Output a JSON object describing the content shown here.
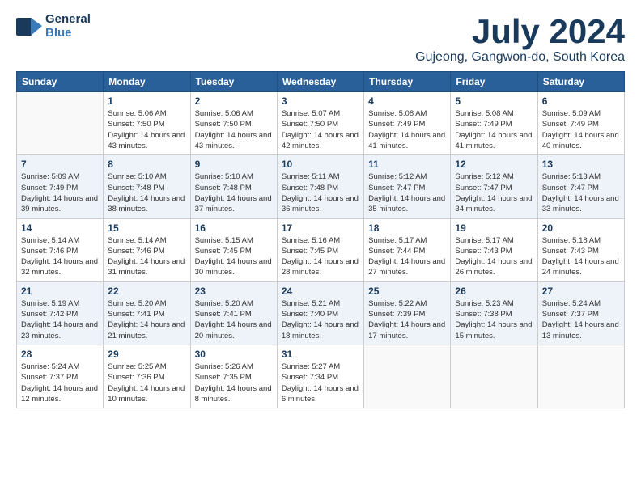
{
  "header": {
    "logo_line1": "General",
    "logo_line2": "Blue",
    "month": "July 2024",
    "location": "Gujeong, Gangwon-do, South Korea"
  },
  "weekdays": [
    "Sunday",
    "Monday",
    "Tuesday",
    "Wednesday",
    "Thursday",
    "Friday",
    "Saturday"
  ],
  "weeks": [
    [
      {
        "day": "",
        "sunrise": "",
        "sunset": "",
        "daylight": ""
      },
      {
        "day": "1",
        "sunrise": "Sunrise: 5:06 AM",
        "sunset": "Sunset: 7:50 PM",
        "daylight": "Daylight: 14 hours and 43 minutes."
      },
      {
        "day": "2",
        "sunrise": "Sunrise: 5:06 AM",
        "sunset": "Sunset: 7:50 PM",
        "daylight": "Daylight: 14 hours and 43 minutes."
      },
      {
        "day": "3",
        "sunrise": "Sunrise: 5:07 AM",
        "sunset": "Sunset: 7:50 PM",
        "daylight": "Daylight: 14 hours and 42 minutes."
      },
      {
        "day": "4",
        "sunrise": "Sunrise: 5:08 AM",
        "sunset": "Sunset: 7:49 PM",
        "daylight": "Daylight: 14 hours and 41 minutes."
      },
      {
        "day": "5",
        "sunrise": "Sunrise: 5:08 AM",
        "sunset": "Sunset: 7:49 PM",
        "daylight": "Daylight: 14 hours and 41 minutes."
      },
      {
        "day": "6",
        "sunrise": "Sunrise: 5:09 AM",
        "sunset": "Sunset: 7:49 PM",
        "daylight": "Daylight: 14 hours and 40 minutes."
      }
    ],
    [
      {
        "day": "7",
        "sunrise": "Sunrise: 5:09 AM",
        "sunset": "Sunset: 7:49 PM",
        "daylight": "Daylight: 14 hours and 39 minutes."
      },
      {
        "day": "8",
        "sunrise": "Sunrise: 5:10 AM",
        "sunset": "Sunset: 7:48 PM",
        "daylight": "Daylight: 14 hours and 38 minutes."
      },
      {
        "day": "9",
        "sunrise": "Sunrise: 5:10 AM",
        "sunset": "Sunset: 7:48 PM",
        "daylight": "Daylight: 14 hours and 37 minutes."
      },
      {
        "day": "10",
        "sunrise": "Sunrise: 5:11 AM",
        "sunset": "Sunset: 7:48 PM",
        "daylight": "Daylight: 14 hours and 36 minutes."
      },
      {
        "day": "11",
        "sunrise": "Sunrise: 5:12 AM",
        "sunset": "Sunset: 7:47 PM",
        "daylight": "Daylight: 14 hours and 35 minutes."
      },
      {
        "day": "12",
        "sunrise": "Sunrise: 5:12 AM",
        "sunset": "Sunset: 7:47 PM",
        "daylight": "Daylight: 14 hours and 34 minutes."
      },
      {
        "day": "13",
        "sunrise": "Sunrise: 5:13 AM",
        "sunset": "Sunset: 7:47 PM",
        "daylight": "Daylight: 14 hours and 33 minutes."
      }
    ],
    [
      {
        "day": "14",
        "sunrise": "Sunrise: 5:14 AM",
        "sunset": "Sunset: 7:46 PM",
        "daylight": "Daylight: 14 hours and 32 minutes."
      },
      {
        "day": "15",
        "sunrise": "Sunrise: 5:14 AM",
        "sunset": "Sunset: 7:46 PM",
        "daylight": "Daylight: 14 hours and 31 minutes."
      },
      {
        "day": "16",
        "sunrise": "Sunrise: 5:15 AM",
        "sunset": "Sunset: 7:45 PM",
        "daylight": "Daylight: 14 hours and 30 minutes."
      },
      {
        "day": "17",
        "sunrise": "Sunrise: 5:16 AM",
        "sunset": "Sunset: 7:45 PM",
        "daylight": "Daylight: 14 hours and 28 minutes."
      },
      {
        "day": "18",
        "sunrise": "Sunrise: 5:17 AM",
        "sunset": "Sunset: 7:44 PM",
        "daylight": "Daylight: 14 hours and 27 minutes."
      },
      {
        "day": "19",
        "sunrise": "Sunrise: 5:17 AM",
        "sunset": "Sunset: 7:43 PM",
        "daylight": "Daylight: 14 hours and 26 minutes."
      },
      {
        "day": "20",
        "sunrise": "Sunrise: 5:18 AM",
        "sunset": "Sunset: 7:43 PM",
        "daylight": "Daylight: 14 hours and 24 minutes."
      }
    ],
    [
      {
        "day": "21",
        "sunrise": "Sunrise: 5:19 AM",
        "sunset": "Sunset: 7:42 PM",
        "daylight": "Daylight: 14 hours and 23 minutes."
      },
      {
        "day": "22",
        "sunrise": "Sunrise: 5:20 AM",
        "sunset": "Sunset: 7:41 PM",
        "daylight": "Daylight: 14 hours and 21 minutes."
      },
      {
        "day": "23",
        "sunrise": "Sunrise: 5:20 AM",
        "sunset": "Sunset: 7:41 PM",
        "daylight": "Daylight: 14 hours and 20 minutes."
      },
      {
        "day": "24",
        "sunrise": "Sunrise: 5:21 AM",
        "sunset": "Sunset: 7:40 PM",
        "daylight": "Daylight: 14 hours and 18 minutes."
      },
      {
        "day": "25",
        "sunrise": "Sunrise: 5:22 AM",
        "sunset": "Sunset: 7:39 PM",
        "daylight": "Daylight: 14 hours and 17 minutes."
      },
      {
        "day": "26",
        "sunrise": "Sunrise: 5:23 AM",
        "sunset": "Sunset: 7:38 PM",
        "daylight": "Daylight: 14 hours and 15 minutes."
      },
      {
        "day": "27",
        "sunrise": "Sunrise: 5:24 AM",
        "sunset": "Sunset: 7:37 PM",
        "daylight": "Daylight: 14 hours and 13 minutes."
      }
    ],
    [
      {
        "day": "28",
        "sunrise": "Sunrise: 5:24 AM",
        "sunset": "Sunset: 7:37 PM",
        "daylight": "Daylight: 14 hours and 12 minutes."
      },
      {
        "day": "29",
        "sunrise": "Sunrise: 5:25 AM",
        "sunset": "Sunset: 7:36 PM",
        "daylight": "Daylight: 14 hours and 10 minutes."
      },
      {
        "day": "30",
        "sunrise": "Sunrise: 5:26 AM",
        "sunset": "Sunset: 7:35 PM",
        "daylight": "Daylight: 14 hours and 8 minutes."
      },
      {
        "day": "31",
        "sunrise": "Sunrise: 5:27 AM",
        "sunset": "Sunset: 7:34 PM",
        "daylight": "Daylight: 14 hours and 6 minutes."
      },
      {
        "day": "",
        "sunrise": "",
        "sunset": "",
        "daylight": ""
      },
      {
        "day": "",
        "sunrise": "",
        "sunset": "",
        "daylight": ""
      },
      {
        "day": "",
        "sunrise": "",
        "sunset": "",
        "daylight": ""
      }
    ]
  ]
}
